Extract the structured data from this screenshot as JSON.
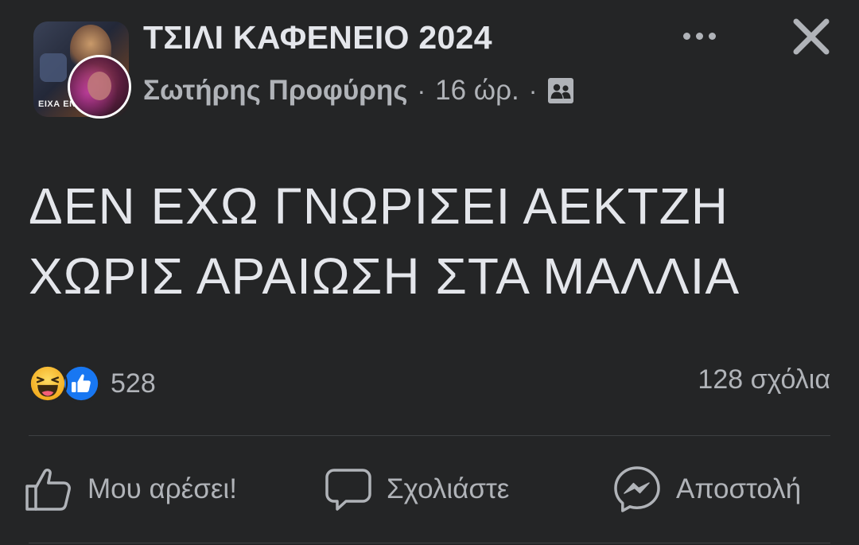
{
  "post": {
    "group_name": "ΤΣΙΛΙ ΚΑΦΕΝΕΙΟ 2024",
    "author": "Σωτήρης Προφύρης",
    "separator": "·",
    "time": "16 ώρ.",
    "privacy_icon": "group-members-icon",
    "group_avatar_caption": "ΕΙΧΑ ΕΝ",
    "text_lines": [
      "ΔΕΝ ΕΧΩ ΓΝΩΡΙΣΕΙ ΑΕΚΤΖΗ",
      "ΧΩΡΙΣ ΑΡΑΙΩΣΗ ΣΤΑ ΜΑΛΛΙΑ"
    ]
  },
  "header_actions": {
    "more_icon": "more-horizontal-icon",
    "close_icon": "close-icon"
  },
  "reactions": {
    "types": [
      "haha",
      "like"
    ],
    "count": "528"
  },
  "comments": {
    "count_label": "128 σχόλια"
  },
  "actions": {
    "like_label": "Μου αρέσει!",
    "comment_label": "Σχολιάστε",
    "share_label": "Αποστολή"
  },
  "colors": {
    "background": "#242526",
    "primary_text": "#e4e6eb",
    "secondary_text": "#b0b3b8",
    "divider": "#3e4042",
    "like_blue": "#1877f2",
    "haha_yellow": "#f7b928"
  }
}
